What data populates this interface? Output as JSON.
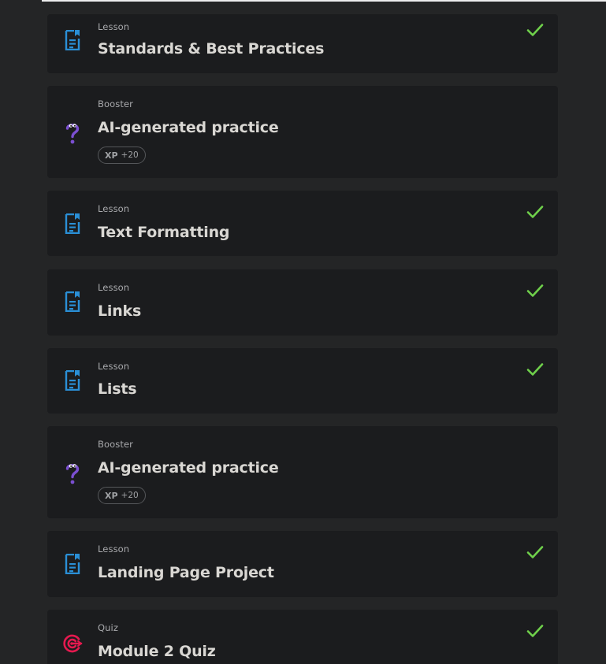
{
  "items": [
    {
      "type": "Lesson",
      "title": "Standards & Best Practices",
      "icon": "lesson-doc-icon",
      "completed": true
    },
    {
      "type": "Booster",
      "title": "AI-generated practice",
      "icon": "question-mark-mascot-icon",
      "xp_label": "XP",
      "xp_value": "+20"
    },
    {
      "type": "Lesson",
      "title": "Text Formatting",
      "icon": "lesson-doc-icon",
      "completed": true
    },
    {
      "type": "Lesson",
      "title": "Links",
      "icon": "lesson-doc-icon",
      "completed": true
    },
    {
      "type": "Lesson",
      "title": "Lists",
      "icon": "lesson-doc-icon",
      "completed": true
    },
    {
      "type": "Booster",
      "title": "AI-generated practice",
      "icon": "question-mark-mascot-icon",
      "xp_label": "XP",
      "xp_value": "+20"
    },
    {
      "type": "Lesson",
      "title": "Landing Page Project",
      "icon": "lesson-doc-icon",
      "completed": true
    },
    {
      "type": "Quiz",
      "title": "Module 2 Quiz",
      "icon": "target-icon",
      "completed": true
    }
  ],
  "colors": {
    "background": "#242526",
    "card": "#1b1c1e",
    "lesson_icon": "#2a8fd6",
    "booster_icon": "#7b4fd1",
    "quiz_icon": "#e5194f",
    "check": "#6fd04b"
  }
}
